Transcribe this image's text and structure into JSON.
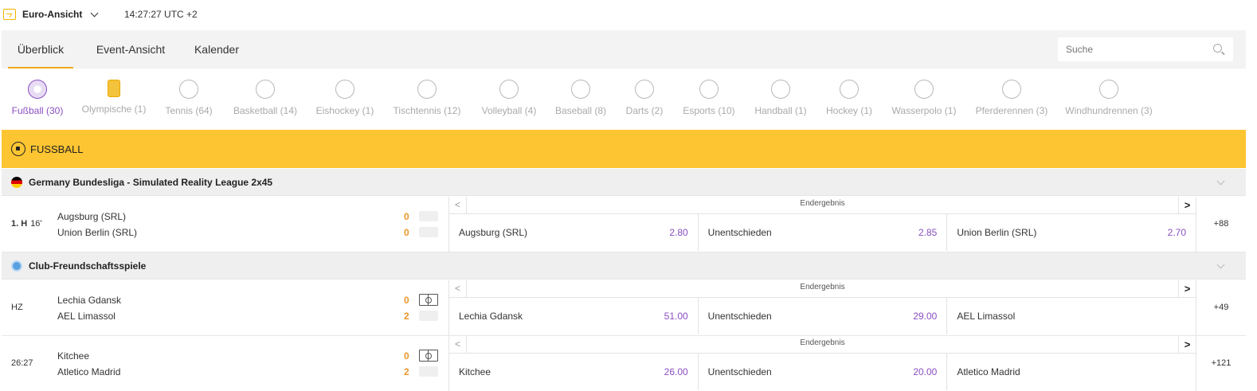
{
  "topbar": {
    "view_label": "Euro-Ansicht",
    "clock": "14:27:27 UTC +2"
  },
  "tabs": [
    {
      "label": "Überblick",
      "active": true
    },
    {
      "label": "Event-Ansicht",
      "active": false
    },
    {
      "label": "Kalender",
      "active": false
    }
  ],
  "search": {
    "placeholder": "Suche"
  },
  "sports": [
    {
      "label": "Fußball (30)",
      "icon": "soccer-ball-icon",
      "active": true
    },
    {
      "label": "Olympische (1)",
      "icon": "medal-icon"
    },
    {
      "label": "Tennis (64)",
      "icon": "tennis-ball-icon"
    },
    {
      "label": "Basketball (14)",
      "icon": "basketball-icon"
    },
    {
      "label": "Eishockey (1)",
      "icon": "hockey-puck-icon"
    },
    {
      "label": "Tischtennis (12)",
      "icon": "table-tennis-icon"
    },
    {
      "label": "Volleyball (4)",
      "icon": "volleyball-icon"
    },
    {
      "label": "Baseball (8)",
      "icon": "baseball-icon"
    },
    {
      "label": "Darts (2)",
      "icon": "dartboard-icon"
    },
    {
      "label": "Esports (10)",
      "icon": "gamepad-icon"
    },
    {
      "label": "Handball (1)",
      "icon": "handball-icon"
    },
    {
      "label": "Hockey (1)",
      "icon": "hockey-stick-icon"
    },
    {
      "label": "Wasserpolo (1)",
      "icon": "water-polo-icon"
    },
    {
      "label": "Pferderennen (3)",
      "icon": "horse-racing-icon"
    },
    {
      "label": "Windhundrennen (3)",
      "icon": "greyhound-icon"
    }
  ],
  "section": {
    "title": "FUSSBALL"
  },
  "leagues": [
    {
      "title": "Germany Bundesliga - Simulated Reality League 2x45",
      "flag": "germany"
    },
    {
      "title": "Club-Freundschaftsspiele",
      "flag": "club"
    }
  ],
  "matches": [
    {
      "period": "1. H",
      "minute": "16'",
      "home": "Augsburg (SRL)",
      "away": "Union Berlin (SRL)",
      "home_score": "0",
      "away_score": "0",
      "market": "Endergebnis",
      "odds": [
        {
          "label": "Augsburg (SRL)",
          "price": "2.80"
        },
        {
          "label": "Unentschieden",
          "price": "2.85"
        },
        {
          "label": "Union Berlin (SRL)",
          "price": "2.70"
        }
      ],
      "more": "+88"
    },
    {
      "period": "HZ",
      "minute": "",
      "home": "Lechia Gdansk",
      "away": "AEL Limassol",
      "home_score": "0",
      "away_score": "2",
      "market": "Endergebnis",
      "odds": [
        {
          "label": "Lechia Gdansk",
          "price": "51.00"
        },
        {
          "label": "Unentschieden",
          "price": "29.00"
        },
        {
          "label": "AEL Limassol",
          "price": ""
        }
      ],
      "more": "+49"
    },
    {
      "period": "26:27",
      "minute": "",
      "home": "Kitchee",
      "away": "Atletico Madrid",
      "home_score": "0",
      "away_score": "2",
      "market": "Endergebnis",
      "odds": [
        {
          "label": "Kitchee",
          "price": "26.00"
        },
        {
          "label": "Unentschieden",
          "price": "20.00"
        },
        {
          "label": "Atletico Madrid",
          "price": ""
        }
      ],
      "more": "+121"
    }
  ]
}
